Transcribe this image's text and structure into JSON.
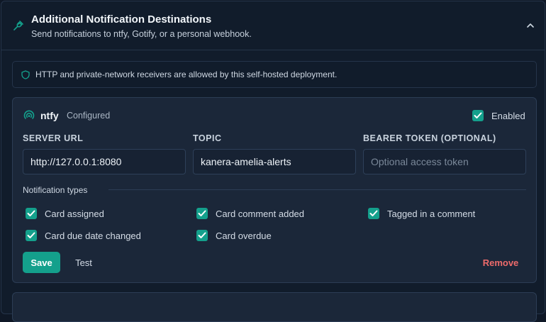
{
  "section": {
    "title": "Additional Notification Destinations",
    "subtitle": "Send notifications to ntfy, Gotify, or a personal webhook."
  },
  "notice": {
    "text": "HTTP and private-network receivers are allowed by this self-hosted deployment."
  },
  "ntfy": {
    "name": "ntfy",
    "status": "Configured",
    "enabled_label": "Enabled",
    "enabled": true,
    "fields": {
      "server_url": {
        "label": "SERVER URL",
        "value": "http://127.0.0.1:8080"
      },
      "topic": {
        "label": "TOPIC",
        "value": "kanera-amelia-alerts"
      },
      "bearer_token": {
        "label": "BEARER TOKEN (OPTIONAL)",
        "value": "",
        "placeholder": "Optional access token"
      }
    },
    "types_label": "Notification types",
    "types": [
      {
        "label": "Card assigned",
        "checked": true
      },
      {
        "label": "Card comment added",
        "checked": true
      },
      {
        "label": "Tagged in a comment",
        "checked": true
      },
      {
        "label": "Card due date changed",
        "checked": true
      },
      {
        "label": "Card overdue",
        "checked": true
      }
    ],
    "save_label": "Save",
    "test_label": "Test",
    "remove_label": "Remove"
  },
  "colors": {
    "accent": "#14a08c",
    "danger": "#ee6b6b",
    "background": "#0f1826",
    "card": "#1b2739"
  },
  "icons": {
    "section": "plug-icon",
    "notice": "shield-icon",
    "ntfy": "broadcast-icon",
    "collapse": "chevron-up-icon"
  }
}
